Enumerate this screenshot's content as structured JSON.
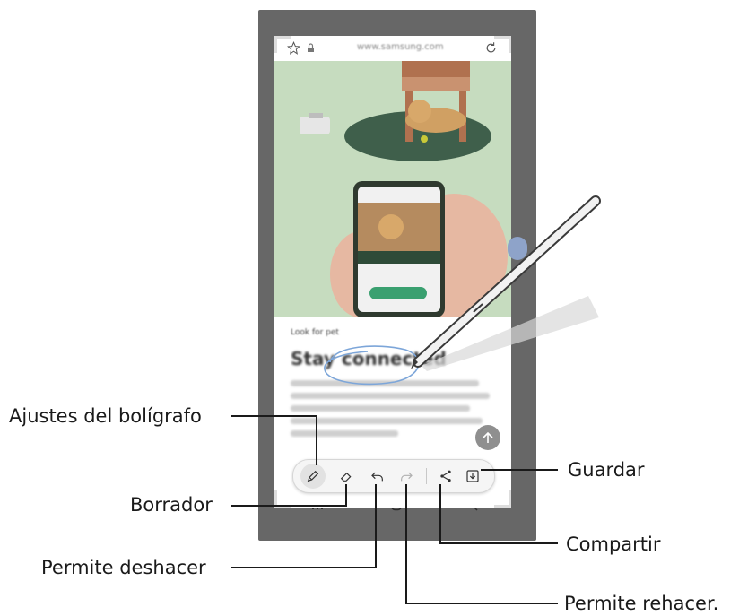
{
  "browser": {
    "url_text": "www.samsung.com",
    "star_icon": "star-outline-icon",
    "lock_icon": "lock-icon",
    "reload_icon": "reload-icon"
  },
  "article": {
    "kicker": "Look for pet",
    "heading": "Stay connected"
  },
  "toolbar": {
    "tools": [
      {
        "name": "pen-settings",
        "icon": "pen-icon"
      },
      {
        "name": "eraser",
        "icon": "eraser-icon"
      },
      {
        "name": "undo",
        "icon": "undo-icon"
      },
      {
        "name": "redo",
        "icon": "redo-icon"
      },
      {
        "name": "share",
        "icon": "share-icon"
      },
      {
        "name": "save",
        "icon": "download-icon"
      }
    ]
  },
  "callouts": {
    "pen_settings": "Ajustes del bolígrafo",
    "eraser": "Borrador",
    "undo": "Permite deshacer",
    "redo": "Permite rehacer.",
    "share": "Compartir",
    "save": "Guardar"
  },
  "colors": {
    "hero_bg": "#c6dcbf",
    "toolbar_bg": "#f5f5f5",
    "annotation_ink": "#7da6d9",
    "phone_frame": "#676767"
  }
}
